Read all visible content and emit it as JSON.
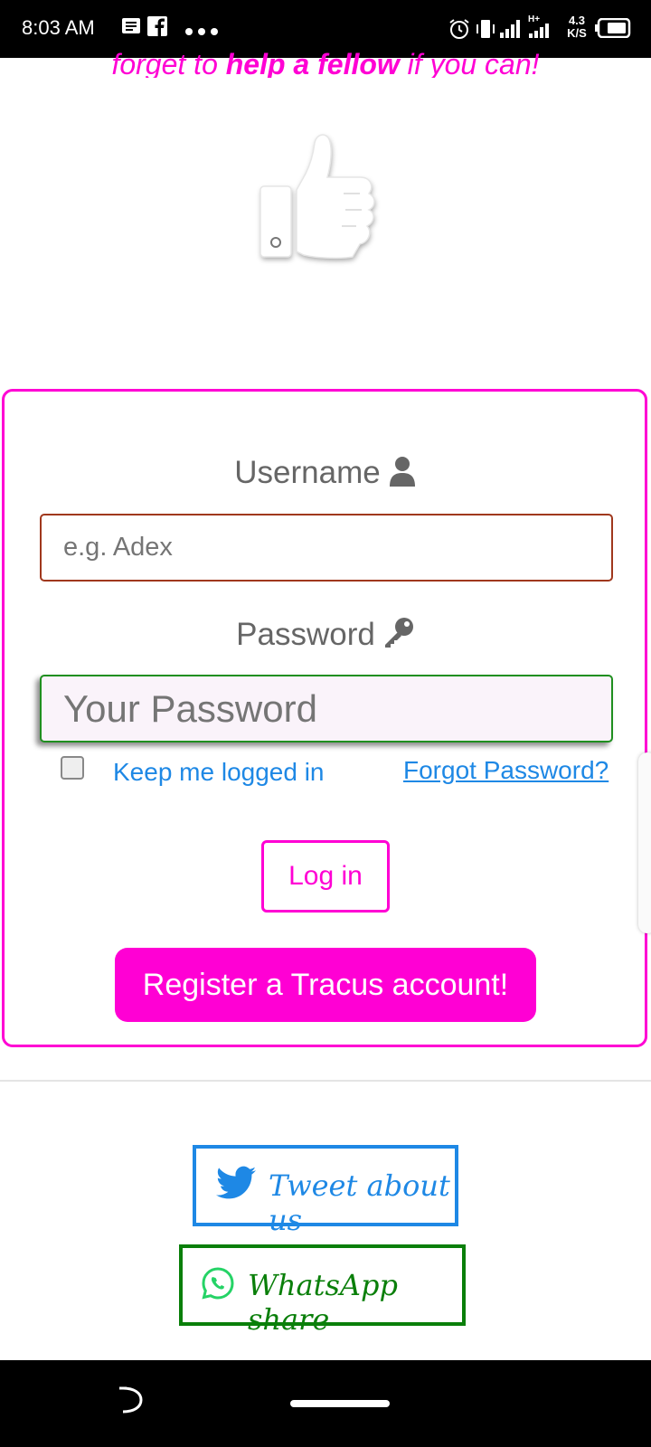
{
  "status_bar": {
    "time": "8:03 AM",
    "notification_icons": [
      "messages-icon",
      "facebook-icon",
      "more-dots-icon"
    ],
    "system_icons": [
      "alarm-icon",
      "vibrate-icon",
      "signal-icon",
      "signal-hplus-icon",
      "battery-icon"
    ],
    "network_type": "H+",
    "speed_value": "4.3",
    "speed_unit": "K/S"
  },
  "page": {
    "tagline_pre": "forget to ",
    "tagline_bold": "help a fellow",
    "tagline_post": " if you can!",
    "hero_icon": "thumbs-up-icon"
  },
  "login": {
    "username_label": "Username",
    "username_placeholder": "e.g. Adex",
    "username_icon": "user-icon",
    "password_label": "Password",
    "password_placeholder": "Your Password",
    "password_icon": "key-icon",
    "keep_logged_in": "Keep me logged in",
    "keep_logged_in_checked": false,
    "forgot_password": "Forgot Password?",
    "login_button": "Log in",
    "register_button": "Register a Tracus account!"
  },
  "share": {
    "tweet_label": "Tweet about us",
    "tweet_icon": "twitter-bird-icon",
    "whatsapp_label": "WhatsApp share",
    "whatsapp_icon": "whatsapp-icon"
  },
  "colors": {
    "accent": "#ff00d4",
    "link": "#1e88e5",
    "twitter": "#1e88e5",
    "whatsapp": "#0a7f0a",
    "whatsapp_icon": "#25d366"
  }
}
